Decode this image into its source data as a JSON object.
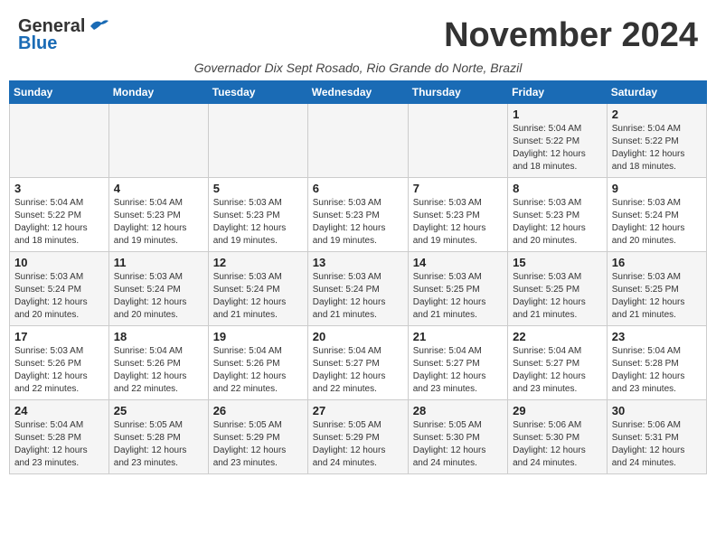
{
  "header": {
    "logo_general": "General",
    "logo_blue": "Blue",
    "month_title": "November 2024",
    "subtitle": "Governador Dix Sept Rosado, Rio Grande do Norte, Brazil"
  },
  "weekdays": [
    "Sunday",
    "Monday",
    "Tuesday",
    "Wednesday",
    "Thursday",
    "Friday",
    "Saturday"
  ],
  "weeks": [
    [
      {
        "day": "",
        "info": ""
      },
      {
        "day": "",
        "info": ""
      },
      {
        "day": "",
        "info": ""
      },
      {
        "day": "",
        "info": ""
      },
      {
        "day": "",
        "info": ""
      },
      {
        "day": "1",
        "info": "Sunrise: 5:04 AM\nSunset: 5:22 PM\nDaylight: 12 hours\nand 18 minutes."
      },
      {
        "day": "2",
        "info": "Sunrise: 5:04 AM\nSunset: 5:22 PM\nDaylight: 12 hours\nand 18 minutes."
      }
    ],
    [
      {
        "day": "3",
        "info": "Sunrise: 5:04 AM\nSunset: 5:22 PM\nDaylight: 12 hours\nand 18 minutes."
      },
      {
        "day": "4",
        "info": "Sunrise: 5:04 AM\nSunset: 5:23 PM\nDaylight: 12 hours\nand 19 minutes."
      },
      {
        "day": "5",
        "info": "Sunrise: 5:03 AM\nSunset: 5:23 PM\nDaylight: 12 hours\nand 19 minutes."
      },
      {
        "day": "6",
        "info": "Sunrise: 5:03 AM\nSunset: 5:23 PM\nDaylight: 12 hours\nand 19 minutes."
      },
      {
        "day": "7",
        "info": "Sunrise: 5:03 AM\nSunset: 5:23 PM\nDaylight: 12 hours\nand 19 minutes."
      },
      {
        "day": "8",
        "info": "Sunrise: 5:03 AM\nSunset: 5:23 PM\nDaylight: 12 hours\nand 20 minutes."
      },
      {
        "day": "9",
        "info": "Sunrise: 5:03 AM\nSunset: 5:24 PM\nDaylight: 12 hours\nand 20 minutes."
      }
    ],
    [
      {
        "day": "10",
        "info": "Sunrise: 5:03 AM\nSunset: 5:24 PM\nDaylight: 12 hours\nand 20 minutes."
      },
      {
        "day": "11",
        "info": "Sunrise: 5:03 AM\nSunset: 5:24 PM\nDaylight: 12 hours\nand 20 minutes."
      },
      {
        "day": "12",
        "info": "Sunrise: 5:03 AM\nSunset: 5:24 PM\nDaylight: 12 hours\nand 21 minutes."
      },
      {
        "day": "13",
        "info": "Sunrise: 5:03 AM\nSunset: 5:24 PM\nDaylight: 12 hours\nand 21 minutes."
      },
      {
        "day": "14",
        "info": "Sunrise: 5:03 AM\nSunset: 5:25 PM\nDaylight: 12 hours\nand 21 minutes."
      },
      {
        "day": "15",
        "info": "Sunrise: 5:03 AM\nSunset: 5:25 PM\nDaylight: 12 hours\nand 21 minutes."
      },
      {
        "day": "16",
        "info": "Sunrise: 5:03 AM\nSunset: 5:25 PM\nDaylight: 12 hours\nand 21 minutes."
      }
    ],
    [
      {
        "day": "17",
        "info": "Sunrise: 5:03 AM\nSunset: 5:26 PM\nDaylight: 12 hours\nand 22 minutes."
      },
      {
        "day": "18",
        "info": "Sunrise: 5:04 AM\nSunset: 5:26 PM\nDaylight: 12 hours\nand 22 minutes."
      },
      {
        "day": "19",
        "info": "Sunrise: 5:04 AM\nSunset: 5:26 PM\nDaylight: 12 hours\nand 22 minutes."
      },
      {
        "day": "20",
        "info": "Sunrise: 5:04 AM\nSunset: 5:27 PM\nDaylight: 12 hours\nand 22 minutes."
      },
      {
        "day": "21",
        "info": "Sunrise: 5:04 AM\nSunset: 5:27 PM\nDaylight: 12 hours\nand 23 minutes."
      },
      {
        "day": "22",
        "info": "Sunrise: 5:04 AM\nSunset: 5:27 PM\nDaylight: 12 hours\nand 23 minutes."
      },
      {
        "day": "23",
        "info": "Sunrise: 5:04 AM\nSunset: 5:28 PM\nDaylight: 12 hours\nand 23 minutes."
      }
    ],
    [
      {
        "day": "24",
        "info": "Sunrise: 5:04 AM\nSunset: 5:28 PM\nDaylight: 12 hours\nand 23 minutes."
      },
      {
        "day": "25",
        "info": "Sunrise: 5:05 AM\nSunset: 5:28 PM\nDaylight: 12 hours\nand 23 minutes."
      },
      {
        "day": "26",
        "info": "Sunrise: 5:05 AM\nSunset: 5:29 PM\nDaylight: 12 hours\nand 23 minutes."
      },
      {
        "day": "27",
        "info": "Sunrise: 5:05 AM\nSunset: 5:29 PM\nDaylight: 12 hours\nand 24 minutes."
      },
      {
        "day": "28",
        "info": "Sunrise: 5:05 AM\nSunset: 5:30 PM\nDaylight: 12 hours\nand 24 minutes."
      },
      {
        "day": "29",
        "info": "Sunrise: 5:06 AM\nSunset: 5:30 PM\nDaylight: 12 hours\nand 24 minutes."
      },
      {
        "day": "30",
        "info": "Sunrise: 5:06 AM\nSunset: 5:31 PM\nDaylight: 12 hours\nand 24 minutes."
      }
    ]
  ]
}
